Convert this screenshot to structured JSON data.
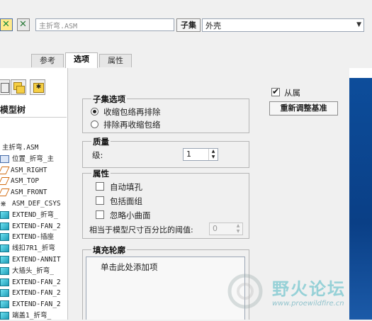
{
  "toolbar": {
    "name_input_value": "主折弯.ASM",
    "subset_button_label": "子集",
    "subset_select_value": "外壳"
  },
  "tabs": [
    {
      "label": "参考",
      "active": false
    },
    {
      "label": "选项",
      "active": true
    },
    {
      "label": "属性",
      "active": false
    }
  ],
  "model_tree": {
    "title": "模型树",
    "rows": [
      {
        "icon": "assembly",
        "label": "主折弯.ASM"
      },
      {
        "icon": "layout",
        "label": "位置_折弯_主"
      },
      {
        "icon": "plane",
        "label": "ASM_RIGHT"
      },
      {
        "icon": "plane",
        "label": "ASM_TOP"
      },
      {
        "icon": "plane",
        "label": "ASM_FRONT"
      },
      {
        "icon": "csys",
        "label": "ASM_DEF_CSYS"
      },
      {
        "icon": "part",
        "label": "EXTEND_折弯_"
      },
      {
        "icon": "part",
        "label": "EXTEND-FAN_2"
      },
      {
        "icon": "part",
        "label": "EXTEND-插座"
      },
      {
        "icon": "part",
        "label": "线扣7R1_折弯"
      },
      {
        "icon": "part",
        "label": "EXTEND-ANNIT"
      },
      {
        "icon": "part",
        "label": "大插头_折弯_"
      },
      {
        "icon": "part",
        "label": "EXTEND-FAN_2"
      },
      {
        "icon": "part",
        "label": "EXTEND-FAN_2"
      },
      {
        "icon": "part",
        "label": "EXTEND-FAN_2"
      },
      {
        "icon": "part",
        "label": "端盖1_折弯_"
      }
    ]
  },
  "subset_options": {
    "title": "子集选项",
    "radio1": {
      "label": "收缩包络再排除",
      "selected": true
    },
    "radio2": {
      "label": "排除再收缩包络",
      "selected": false
    }
  },
  "quality": {
    "title": "质量",
    "level_label": "级:",
    "level_value": "1"
  },
  "attributes": {
    "title": "属性",
    "check1": {
      "label": "自动填孔",
      "checked": false
    },
    "check2": {
      "label": "包括面组",
      "checked": false
    },
    "check3": {
      "label": "忽略小曲面",
      "checked": false
    },
    "threshold_label": "相当于模型尺寸百分比的阈值:",
    "threshold_value": "0"
  },
  "fill_contour": {
    "title": "填充轮廓",
    "placeholder": "单击此处添加项"
  },
  "right_panel": {
    "dependent_label": "从属",
    "dependent_checked": true,
    "realign_button": "重新调整基准"
  },
  "watermark": {
    "text": "野火论坛",
    "url": "www.proewildfire.cn"
  },
  "colors": {
    "accent_blue": "#0d4d9b",
    "part_cyan": "#1f9db7",
    "plane_orange": "#d26b10"
  }
}
